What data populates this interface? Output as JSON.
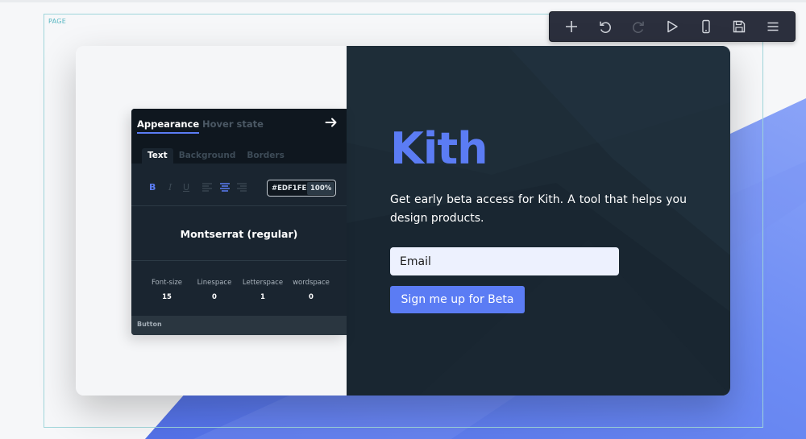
{
  "canvas": {
    "page_label": "PAGE"
  },
  "toolbar": {
    "buttons": [
      {
        "name": "add",
        "icon": "plus-icon"
      },
      {
        "name": "undo",
        "icon": "undo-icon"
      },
      {
        "name": "redo",
        "icon": "redo-icon",
        "disabled": true
      },
      {
        "name": "preview",
        "icon": "play-icon"
      },
      {
        "name": "mobile-view",
        "icon": "phone-icon"
      },
      {
        "name": "save",
        "icon": "floppy-disk-icon"
      },
      {
        "name": "menu",
        "icon": "hamburger-menu-icon"
      }
    ]
  },
  "panel": {
    "tabs": [
      "Appearance",
      "Hover state"
    ],
    "active_tab": "Appearance",
    "subtabs": [
      "Text",
      "Background",
      "Borders"
    ],
    "active_subtab": "Text",
    "format": {
      "bold": "B",
      "italic": "I",
      "underline": "U",
      "active": "bold",
      "alignment": "center"
    },
    "color": {
      "hex": "#EDF1FE",
      "opacity": "100%"
    },
    "font": "Montserrat (regular)",
    "metrics": [
      {
        "label": "Font-size",
        "value": "15"
      },
      {
        "label": "Linespace",
        "value": "0"
      },
      {
        "label": "Letterspace",
        "value": "1"
      },
      {
        "label": "wordspace",
        "value": "0"
      }
    ],
    "footer": "Button"
  },
  "hero": {
    "title": "Kith",
    "description": "Get early beta access for Kith. A tool that helps you design products.",
    "email_placeholder": "Email",
    "button_label": "Sign me up for Beta"
  },
  "colors": {
    "accent": "#5B7CF4",
    "dark_panel": "#1C2A35",
    "input_bg": "#EDF1FE",
    "toolbar_bg": "#2B2F3D"
  }
}
